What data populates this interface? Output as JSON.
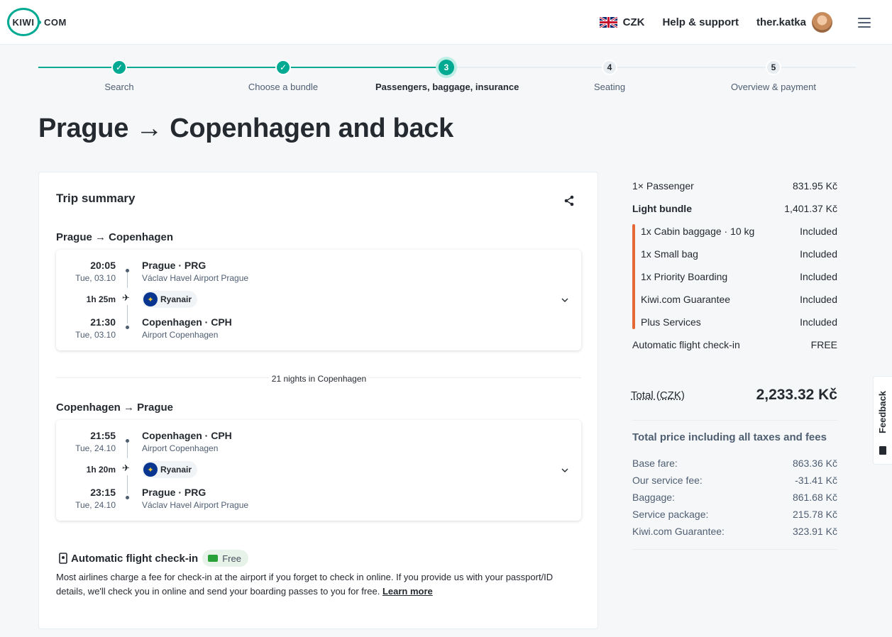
{
  "header": {
    "logo_main": "KIWI",
    "logo_com": "COM",
    "currency": "CZK",
    "help": "Help & support",
    "user": "ther.katka"
  },
  "steps": [
    {
      "num": "1",
      "label": "Search",
      "state": "done"
    },
    {
      "num": "2",
      "label": "Choose a bundle",
      "state": "done"
    },
    {
      "num": "3",
      "label": "Passengers, baggage, insurance",
      "state": "current"
    },
    {
      "num": "4",
      "label": "Seating",
      "state": "todo"
    },
    {
      "num": "5",
      "label": "Overview & payment",
      "state": "todo"
    }
  ],
  "page_title": "Prague → Copenhagen and back",
  "trip": {
    "title": "Trip summary",
    "outbound": {
      "heading": "Prague → Copenhagen",
      "dep_time": "20:05",
      "dep_date": "Tue, 03.10",
      "dep_place": "Prague · PRG",
      "dep_airport": "Václav Havel Airport Prague",
      "duration": "1h 25m",
      "carrier": "Ryanair",
      "arr_time": "21:30",
      "arr_date": "Tue, 03.10",
      "arr_place": "Copenhagen · CPH",
      "arr_airport": "Airport Copenhagen"
    },
    "nights": "21 nights in Copenhagen",
    "inbound": {
      "heading": "Copenhagen → Prague",
      "dep_time": "21:55",
      "dep_date": "Tue, 24.10",
      "dep_place": "Copenhagen · CPH",
      "dep_airport": "Airport Copenhagen",
      "duration": "1h 20m",
      "carrier": "Ryanair",
      "arr_time": "23:15",
      "arr_date": "Tue, 24.10",
      "arr_place": "Prague · PRG",
      "arr_airport": "Václav Havel Airport Prague"
    },
    "checkin": {
      "title": "Automatic flight check-in",
      "badge": "Free",
      "text": "Most airlines charge a fee for check-in at the airport if you forget to check in online. If you provide us with your passport/ID details, we'll check you in online and send your boarding passes to you for free.",
      "link": "Learn more"
    }
  },
  "summary": {
    "passenger": {
      "label": "1× Passenger",
      "value": "831.95 Kč"
    },
    "bundle": {
      "label": "Light bundle",
      "value": "1,401.37 Kč"
    },
    "items": [
      {
        "label": "1x Cabin baggage · 10 kg",
        "value": "Included"
      },
      {
        "label": "1x Small bag",
        "value": "Included"
      },
      {
        "label": "1x Priority Boarding",
        "value": "Included"
      },
      {
        "label": "Kiwi.com Guarantee",
        "value": "Included"
      },
      {
        "label": "Plus Services",
        "value": "Included"
      }
    ],
    "checkin": {
      "label": "Automatic flight check-in",
      "value": "FREE"
    },
    "total_label": "Total (CZK)",
    "total_value": "2,233.32 Kč",
    "taxes_title": "Total price including all taxes and fees",
    "breakdown": [
      {
        "label": "Base fare:",
        "value": "863.36 Kč"
      },
      {
        "label": "Our service fee:",
        "value": "-31.41 Kč"
      },
      {
        "label": "Baggage:",
        "value": "861.68 Kč"
      },
      {
        "label": "Service package:",
        "value": "215.78 Kč"
      },
      {
        "label": "Kiwi.com Guarantee:",
        "value": "323.91 Kč"
      }
    ]
  },
  "feedback": "Feedback",
  "colors": {
    "accent": "#00a991",
    "bundle_bar": "#e46936",
    "free_badge": "#e7f3e8"
  }
}
